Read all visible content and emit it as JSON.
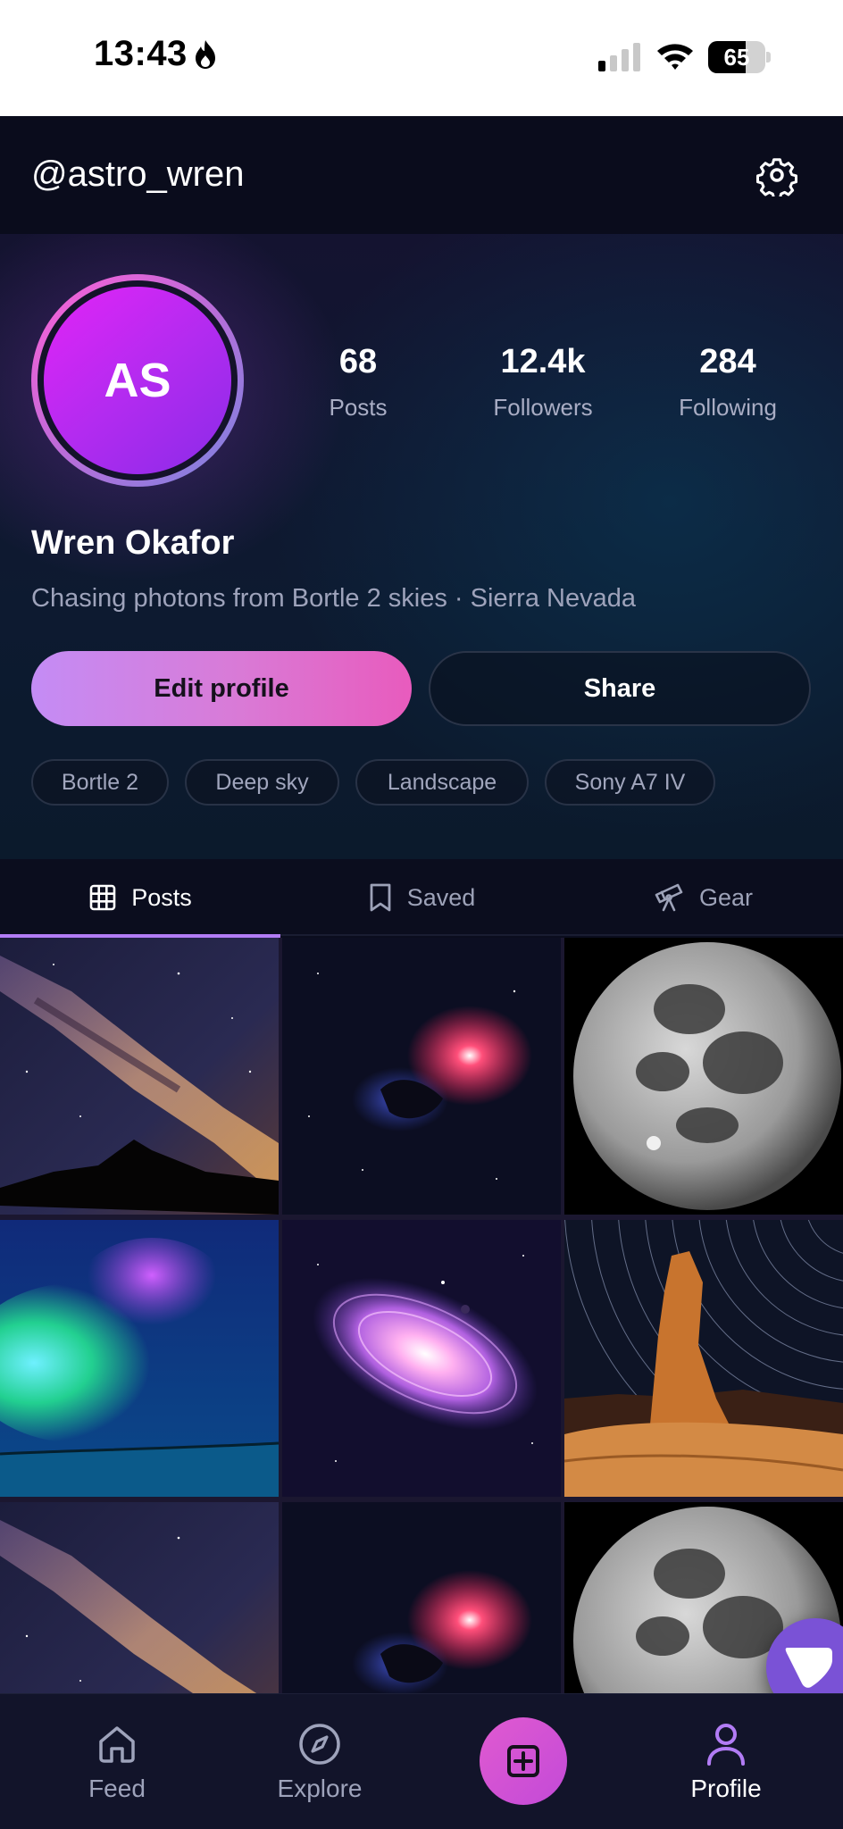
{
  "status_bar": {
    "time": "13:43",
    "battery": "65",
    "battery_level": 0.65
  },
  "header": {
    "handle": "@astro_wren",
    "settings_icon": "gear-icon"
  },
  "profile": {
    "initials": "AS",
    "name": "Wren Okafor",
    "bio": "Chasing photons from Bortle 2 skies · Sierra Nevada",
    "stats": [
      {
        "value": "68",
        "label": "Posts"
      },
      {
        "value": "12.4k",
        "label": "Followers"
      },
      {
        "value": "284",
        "label": "Following"
      }
    ],
    "edit_label": "Edit profile",
    "share_label": "Share",
    "tags": [
      "Bortle 2",
      "Deep sky",
      "Landscape",
      "Sony A7 IV"
    ]
  },
  "tabs": [
    {
      "label": "Posts",
      "icon": "grid-icon",
      "active": true
    },
    {
      "label": "Saved",
      "icon": "bookmark-icon",
      "active": false
    },
    {
      "label": "Gear",
      "icon": "telescope-icon",
      "active": false
    }
  ],
  "grid_photos": [
    "milky-way",
    "nebula",
    "moon",
    "aurora",
    "galaxy",
    "star-trails",
    "milky-way",
    "nebula",
    "moon"
  ],
  "bottom_nav": [
    {
      "label": "Feed",
      "icon": "home-icon",
      "active": false
    },
    {
      "label": "Explore",
      "icon": "compass-icon",
      "active": false
    },
    {
      "label": "",
      "icon": "plus-square-icon",
      "active": false
    },
    {
      "label": "Profile",
      "icon": "user-icon",
      "active": true
    }
  ],
  "colors": {
    "accent": "#b27cf5",
    "pink": "#e05ad0",
    "background": "#0b0d1e"
  }
}
